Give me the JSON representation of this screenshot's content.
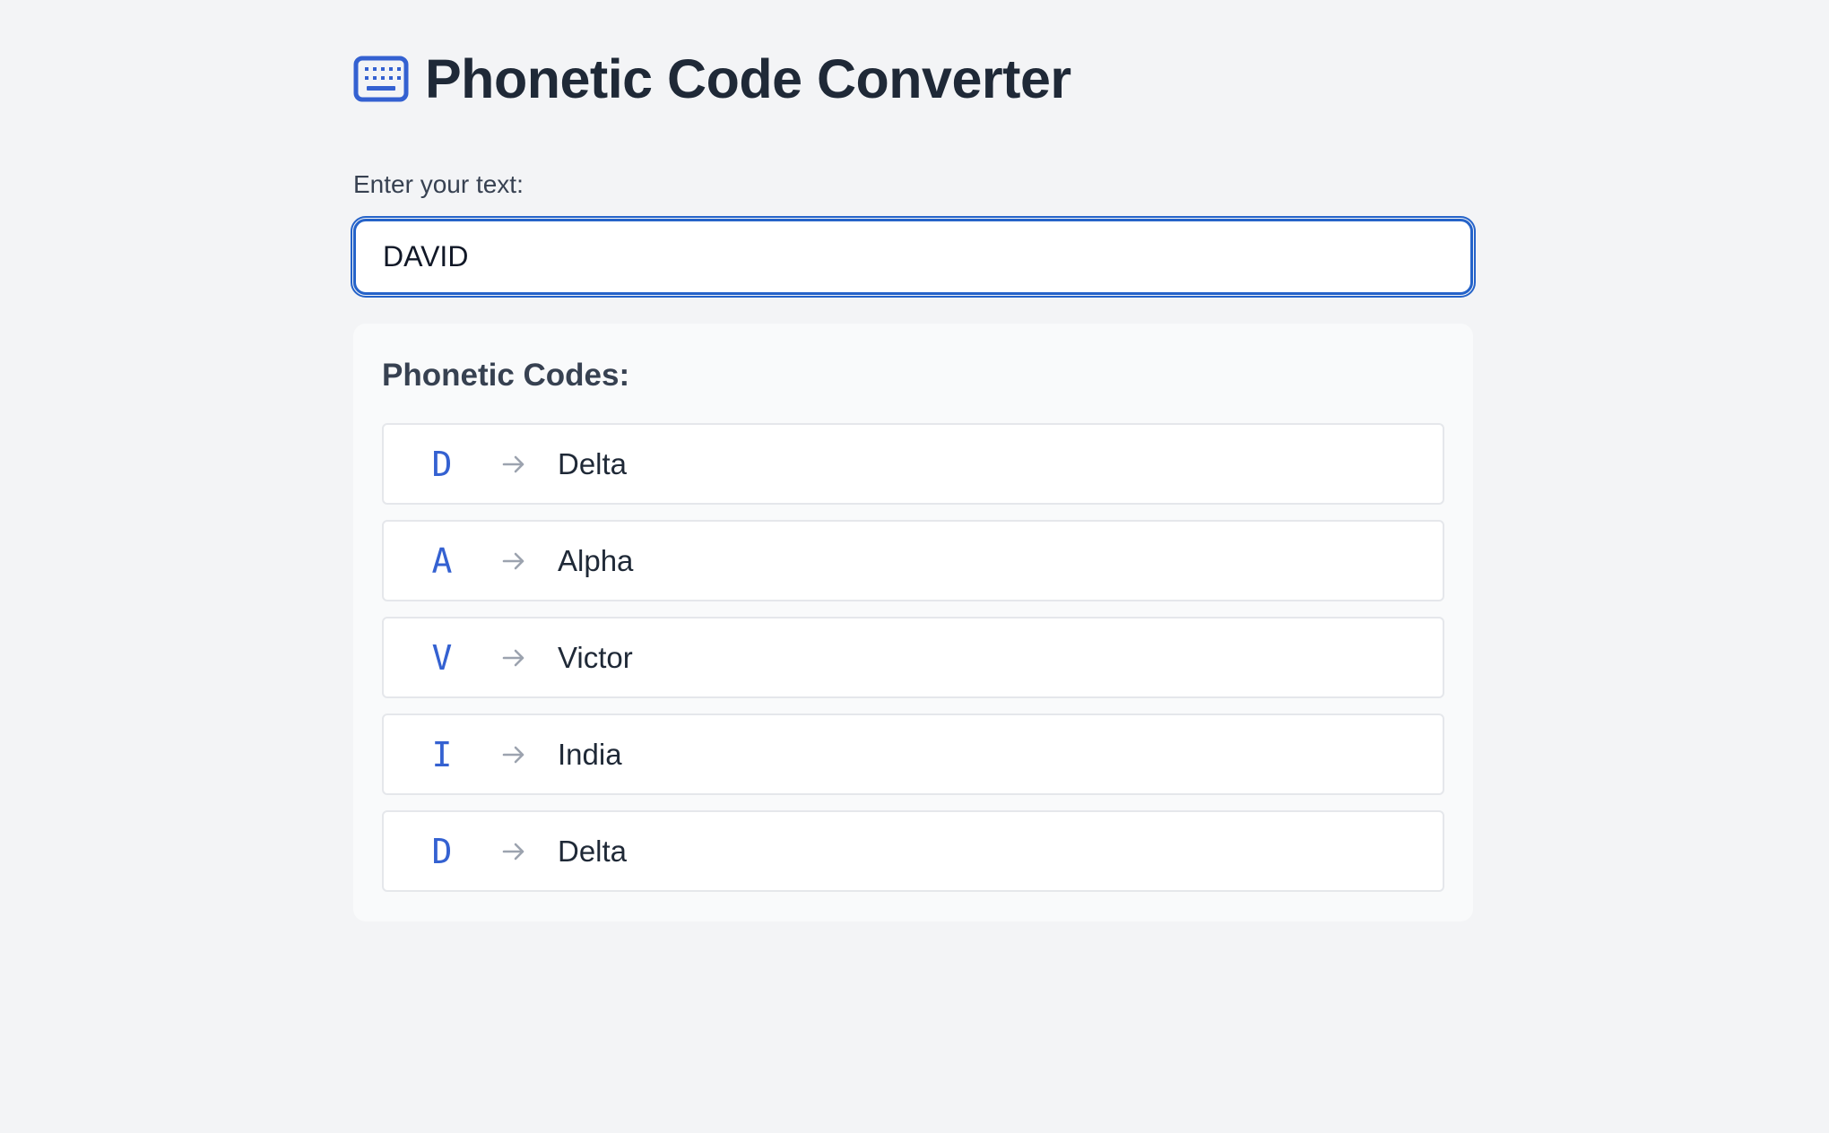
{
  "header": {
    "icon": "keyboard-icon",
    "title": "Phonetic Code Converter"
  },
  "input": {
    "label": "Enter your text:",
    "value": "DAVID"
  },
  "results": {
    "title": "Phonetic Codes:",
    "arrow_icon": "arrow-right-icon",
    "items": [
      {
        "letter": "D",
        "word": "Delta"
      },
      {
        "letter": "A",
        "word": "Alpha"
      },
      {
        "letter": "V",
        "word": "Victor"
      },
      {
        "letter": "I",
        "word": "India"
      },
      {
        "letter": "D",
        "word": "Delta"
      }
    ]
  },
  "colors": {
    "accent": "#3461d1",
    "input_border": "#2563c9",
    "background": "#f3f4f6",
    "panel": "#f9fafb"
  }
}
